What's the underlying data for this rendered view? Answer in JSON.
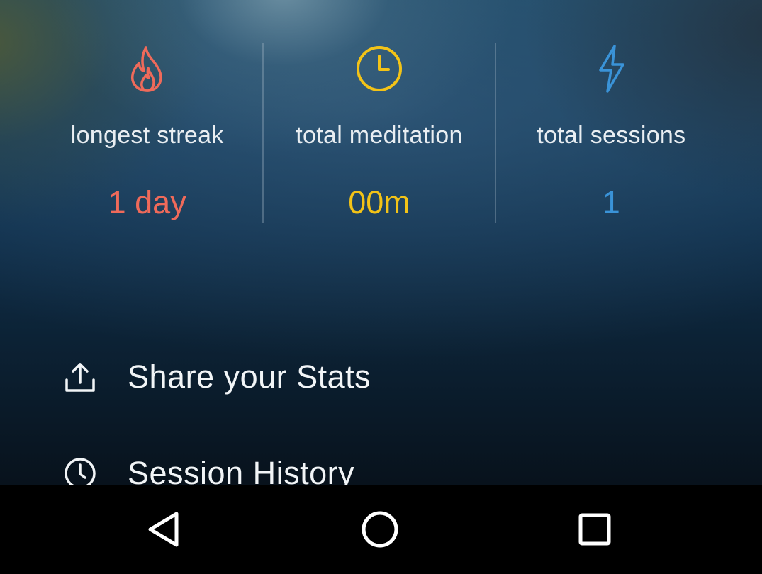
{
  "stats": [
    {
      "icon": "flame-icon",
      "label": "longest streak",
      "value": "1 day",
      "color": "#ef6a5a"
    },
    {
      "icon": "clock-icon",
      "label": "total meditation",
      "value": "00m",
      "color": "#f3c317"
    },
    {
      "icon": "lightning-bolt-icon",
      "label": "total sessions",
      "value": "1",
      "color": "#3a93d8"
    }
  ],
  "menu": {
    "share": {
      "icon": "share-upload-icon",
      "label": "Share your Stats"
    },
    "history": {
      "icon": "history-clock-icon",
      "label": "Session History"
    }
  },
  "navbar": {
    "back_icon": "back-triangle-icon",
    "home_icon": "home-circle-icon",
    "recents_icon": "recents-square-icon"
  }
}
